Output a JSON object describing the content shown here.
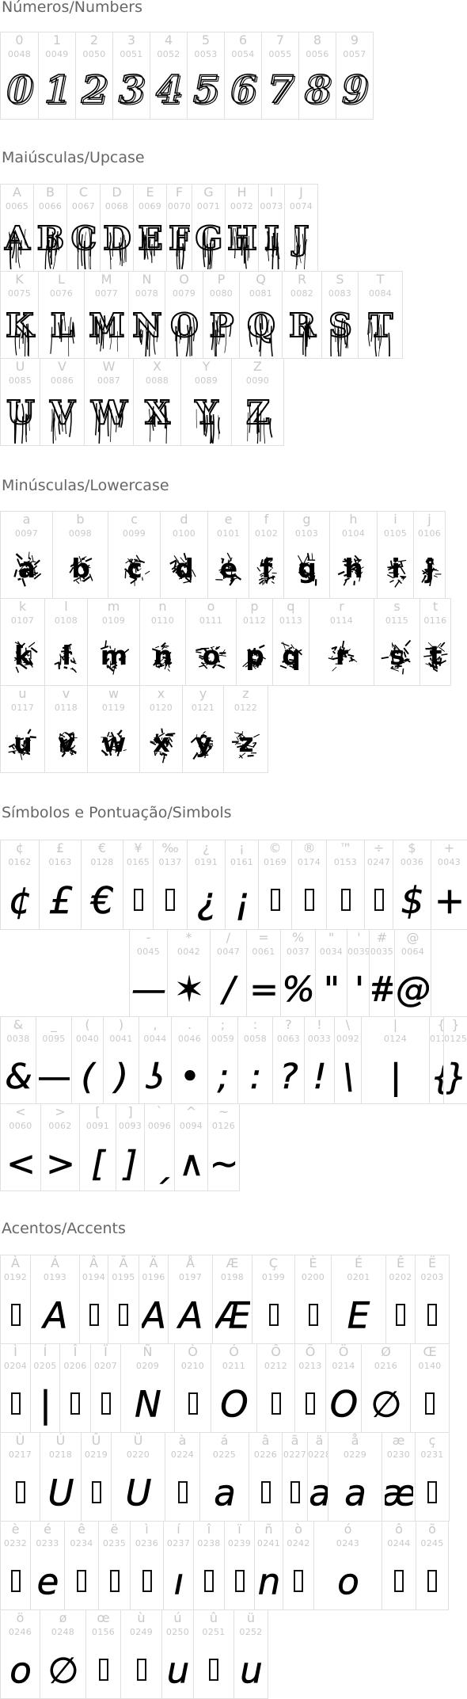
{
  "sections": [
    {
      "title": "Números/Numbers",
      "glyphs": [
        {
          "char": "0",
          "code": "0048",
          "style": "hand"
        },
        {
          "char": "1",
          "code": "0049",
          "style": "hand"
        },
        {
          "char": "2",
          "code": "0050",
          "style": "hand"
        },
        {
          "char": "3",
          "code": "0051",
          "style": "hand"
        },
        {
          "char": "4",
          "code": "0052",
          "style": "hand"
        },
        {
          "char": "5",
          "code": "0053",
          "style": "hand"
        },
        {
          "char": "6",
          "code": "0054",
          "style": "hand"
        },
        {
          "char": "7",
          "code": "0055",
          "style": "hand"
        },
        {
          "char": "8",
          "code": "0056",
          "style": "hand"
        },
        {
          "char": "9",
          "code": "0057",
          "style": "hand"
        }
      ]
    },
    {
      "title": "Maiúsculas/Upcase",
      "glyphs": [
        {
          "char": "A",
          "code": "0065",
          "style": "drip"
        },
        {
          "char": "B",
          "code": "0066",
          "style": "drip"
        },
        {
          "char": "C",
          "code": "0067",
          "style": "drip"
        },
        {
          "char": "D",
          "code": "0068",
          "style": "drip"
        },
        {
          "char": "E",
          "code": "0069",
          "style": "drip"
        },
        {
          "char": "F",
          "code": "0070",
          "style": "drip"
        },
        {
          "char": "G",
          "code": "0071",
          "style": "drip"
        },
        {
          "char": "H",
          "code": "0072",
          "style": "drip"
        },
        {
          "char": "I",
          "code": "0073",
          "style": "drip"
        },
        {
          "char": "J",
          "code": "0074",
          "style": "drip"
        },
        {
          "char": "K",
          "code": "0075",
          "style": "drip"
        },
        {
          "char": "L",
          "code": "0076",
          "style": "drip"
        },
        {
          "char": "M",
          "code": "0077",
          "style": "drip"
        },
        {
          "char": "N",
          "code": "0078",
          "style": "drip"
        },
        {
          "char": "O",
          "code": "0079",
          "style": "drip"
        },
        {
          "char": "P",
          "code": "0080",
          "style": "drip"
        },
        {
          "char": "Q",
          "code": "0081",
          "style": "drip"
        },
        {
          "char": "R",
          "code": "0082",
          "style": "drip"
        },
        {
          "char": "S",
          "code": "0083",
          "style": "drip"
        },
        {
          "char": "T",
          "code": "0084",
          "style": "drip"
        },
        {
          "char": "U",
          "code": "0085",
          "style": "drip"
        },
        {
          "char": "V",
          "code": "0086",
          "style": "drip"
        },
        {
          "char": "W",
          "code": "0087",
          "style": "drip"
        },
        {
          "char": "X",
          "code": "0088",
          "style": "drip"
        },
        {
          "char": "Y",
          "code": "0089",
          "style": "drip"
        },
        {
          "char": "Z",
          "code": "0090",
          "style": "drip"
        }
      ]
    },
    {
      "title": "Minúsculas/Lowercase",
      "glyphs": [
        {
          "char": "a",
          "code": "0097",
          "style": "splat"
        },
        {
          "char": "b",
          "code": "0098",
          "style": "splat"
        },
        {
          "char": "c",
          "code": "0099",
          "style": "splat"
        },
        {
          "char": "d",
          "code": "0100",
          "style": "splat"
        },
        {
          "char": "e",
          "code": "0101",
          "style": "splat"
        },
        {
          "char": "f",
          "code": "0102",
          "style": "splat"
        },
        {
          "char": "g",
          "code": "0103",
          "style": "splat"
        },
        {
          "char": "h",
          "code": "0104",
          "style": "splat"
        },
        {
          "char": "i",
          "code": "0105",
          "style": "splat"
        },
        {
          "char": "j",
          "code": "0106",
          "style": "splat"
        },
        {
          "char": "k",
          "code": "0107",
          "style": "splat"
        },
        {
          "char": "l",
          "code": "0108",
          "style": "splat"
        },
        {
          "char": "m",
          "code": "0109",
          "style": "splat"
        },
        {
          "char": "n",
          "code": "0110",
          "style": "splat"
        },
        {
          "char": "o",
          "code": "0111",
          "style": "splat"
        },
        {
          "char": "p",
          "code": "0112",
          "style": "splat"
        },
        {
          "char": "q",
          "code": "0113",
          "style": "splat"
        },
        {
          "char": "r",
          "code": "0114",
          "style": "splat"
        },
        {
          "char": "s",
          "code": "0115",
          "style": "splat"
        },
        {
          "char": "t",
          "code": "0116",
          "style": "splat"
        },
        {
          "char": "u",
          "code": "0117",
          "style": "splat"
        },
        {
          "char": "v",
          "code": "0118",
          "style": "splat"
        },
        {
          "char": "w",
          "code": "0119",
          "style": "splat"
        },
        {
          "char": "x",
          "code": "0120",
          "style": "splat"
        },
        {
          "char": "y",
          "code": "0121",
          "style": "splat"
        },
        {
          "char": "z",
          "code": "0122",
          "style": "splat"
        }
      ]
    },
    {
      "title": "Símbolos e Pontuação/Simbols",
      "glyphs": [
        {
          "char": "¢",
          "code": "0162",
          "style": "pen",
          "g": "¢"
        },
        {
          "char": "£",
          "code": "0163",
          "style": "pen",
          "g": "£"
        },
        {
          "char": "€",
          "code": "0128",
          "style": "pen",
          "g": "€"
        },
        {
          "char": "¥",
          "code": "0165",
          "style": "box"
        },
        {
          "char": "‰",
          "code": "0137",
          "style": "box"
        },
        {
          "char": "¿",
          "code": "0191",
          "style": "pen",
          "g": "¿"
        },
        {
          "char": "¡",
          "code": "0161",
          "style": "pen",
          "g": "¡"
        },
        {
          "char": "©",
          "code": "0169",
          "style": "box"
        },
        {
          "char": "®",
          "code": "0174",
          "style": "box"
        },
        {
          "char": "™",
          "code": "0153",
          "style": "box"
        },
        {
          "char": "÷",
          "code": "0247",
          "style": "box"
        },
        {
          "char": "$",
          "code": "0036",
          "style": "pen",
          "g": "$"
        },
        {
          "char": "+",
          "code": "0043",
          "style": "pen",
          "g": "+"
        },
        {
          "char": "-",
          "code": "0045",
          "style": "pen",
          "g": "—"
        },
        {
          "char": "*",
          "code": "0042",
          "style": "pen",
          "g": "✶"
        },
        {
          "char": "/",
          "code": "0047",
          "style": "pen",
          "g": "/"
        },
        {
          "char": "=",
          "code": "0061",
          "style": "pen",
          "g": "="
        },
        {
          "char": "%",
          "code": "0037",
          "style": "pen",
          "g": "%"
        },
        {
          "char": "\"",
          "code": "0034",
          "style": "pen",
          "g": "\""
        },
        {
          "char": "'",
          "code": "0039",
          "style": "pen",
          "g": "'"
        },
        {
          "char": "#",
          "code": "0035",
          "style": "pen",
          "g": "#"
        },
        {
          "char": "@",
          "code": "0064",
          "style": "pen",
          "g": "@"
        },
        {
          "char": "&",
          "code": "0038",
          "style": "pen",
          "g": "&"
        },
        {
          "char": "_",
          "code": "0095",
          "style": "pen",
          "g": "—"
        },
        {
          "char": "(",
          "code": "0040",
          "style": "pen",
          "g": "("
        },
        {
          "char": ")",
          "code": "0041",
          "style": "pen",
          "g": ")"
        },
        {
          "char": ",",
          "code": "0044",
          "style": "pen",
          "g": "ʖ"
        },
        {
          "char": ".",
          "code": "0046",
          "style": "pen",
          "g": "•"
        },
        {
          "char": ";",
          "code": "0059",
          "style": "pen",
          "g": ";"
        },
        {
          "char": ":",
          "code": "0058",
          "style": "pen",
          "g": ":"
        },
        {
          "char": "?",
          "code": "0063",
          "style": "pen",
          "g": "?"
        },
        {
          "char": "!",
          "code": "0033",
          "style": "pen",
          "g": "!"
        },
        {
          "char": "\\",
          "code": "0092",
          "style": "pen",
          "g": "\\"
        },
        {
          "char": "|",
          "code": "0124",
          "style": "pen",
          "g": "|"
        },
        {
          "char": "{",
          "code": "0123",
          "style": "pen",
          "g": "{"
        },
        {
          "char": "}",
          "code": "0125",
          "style": "pen",
          "g": "}"
        },
        {
          "char": "<",
          "code": "0060",
          "style": "pen",
          "g": "<"
        },
        {
          "char": ">",
          "code": "0062",
          "style": "pen",
          "g": ">"
        },
        {
          "char": "[",
          "code": "0091",
          "style": "pen",
          "g": "["
        },
        {
          "char": "]",
          "code": "0093",
          "style": "pen",
          "g": "]"
        },
        {
          "char": "`",
          "code": "0096",
          "style": "pen",
          "g": "ˏ"
        },
        {
          "char": "^",
          "code": "0094",
          "style": "pen",
          "g": "∧"
        },
        {
          "char": "~",
          "code": "0126",
          "style": "pen",
          "g": "~"
        }
      ]
    },
    {
      "title": "Acentos/Accents",
      "glyphs": [
        {
          "char": "À",
          "code": "0192",
          "style": "box"
        },
        {
          "char": "Á",
          "code": "0193",
          "style": "pen",
          "g": "A"
        },
        {
          "char": "Â",
          "code": "0194",
          "style": "box"
        },
        {
          "char": "Ã",
          "code": "0195",
          "style": "box"
        },
        {
          "char": "Ä",
          "code": "0196",
          "style": "pen",
          "g": "A"
        },
        {
          "char": "Å",
          "code": "0197",
          "style": "pen",
          "g": "A"
        },
        {
          "char": "Æ",
          "code": "0198",
          "style": "pen",
          "g": "Æ"
        },
        {
          "char": "Ç",
          "code": "0199",
          "style": "box"
        },
        {
          "char": "È",
          "code": "0200",
          "style": "box"
        },
        {
          "char": "É",
          "code": "0201",
          "style": "pen",
          "g": "E"
        },
        {
          "char": "Ê",
          "code": "0202",
          "style": "box"
        },
        {
          "char": "Ë",
          "code": "0203",
          "style": "box"
        },
        {
          "char": "Ì",
          "code": "0204",
          "style": "box"
        },
        {
          "char": "Í",
          "code": "0205",
          "style": "pen",
          "g": "|"
        },
        {
          "char": "Î",
          "code": "0206",
          "style": "box"
        },
        {
          "char": "Ï",
          "code": "0207",
          "style": "box"
        },
        {
          "char": "Ñ",
          "code": "0209",
          "style": "pen",
          "g": "N"
        },
        {
          "char": "Ò",
          "code": "0210",
          "style": "box"
        },
        {
          "char": "Ó",
          "code": "0211",
          "style": "pen",
          "g": "O"
        },
        {
          "char": "Ô",
          "code": "0212",
          "style": "box"
        },
        {
          "char": "Õ",
          "code": "0213",
          "style": "box"
        },
        {
          "char": "Ö",
          "code": "0214",
          "style": "pen",
          "g": "O"
        },
        {
          "char": "Ø",
          "code": "0216",
          "style": "pen",
          "g": "∅"
        },
        {
          "char": "Œ",
          "code": "0140",
          "style": "box"
        },
        {
          "char": "Ù",
          "code": "0217",
          "style": "box"
        },
        {
          "char": "Ú",
          "code": "0218",
          "style": "pen",
          "g": "U"
        },
        {
          "char": "Û",
          "code": "0219",
          "style": "box"
        },
        {
          "char": "Ü",
          "code": "0220",
          "style": "pen",
          "g": "U"
        },
        {
          "char": "à",
          "code": "0224",
          "style": "box"
        },
        {
          "char": "á",
          "code": "0225",
          "style": "pen",
          "g": "a"
        },
        {
          "char": "â",
          "code": "0226",
          "style": "box"
        },
        {
          "char": "ã",
          "code": "0227",
          "style": "box"
        },
        {
          "char": "ä",
          "code": "0228",
          "style": "pen",
          "g": "a"
        },
        {
          "char": "å",
          "code": "0229",
          "style": "pen",
          "g": "a"
        },
        {
          "char": "æ",
          "code": "0230",
          "style": "pen",
          "g": "æ"
        },
        {
          "char": "ç",
          "code": "0231",
          "style": "box"
        },
        {
          "char": "è",
          "code": "0232",
          "style": "box"
        },
        {
          "char": "é",
          "code": "0233",
          "style": "pen",
          "g": "e"
        },
        {
          "char": "ê",
          "code": "0234",
          "style": "box"
        },
        {
          "char": "ë",
          "code": "0235",
          "style": "box"
        },
        {
          "char": "ì",
          "code": "0236",
          "style": "box"
        },
        {
          "char": "í",
          "code": "0237",
          "style": "pen",
          "g": "ı"
        },
        {
          "char": "î",
          "code": "0238",
          "style": "box"
        },
        {
          "char": "ï",
          "code": "0239",
          "style": "box"
        },
        {
          "char": "ñ",
          "code": "0241",
          "style": "pen",
          "g": "n"
        },
        {
          "char": "ò",
          "code": "0242",
          "style": "box"
        },
        {
          "char": "ó",
          "code": "0243",
          "style": "pen",
          "g": "o"
        },
        {
          "char": "ô",
          "code": "0244",
          "style": "box"
        },
        {
          "char": "õ",
          "code": "0245",
          "style": "box"
        },
        {
          "char": "ö",
          "code": "0246",
          "style": "pen",
          "g": "o"
        },
        {
          "char": "ø",
          "code": "0248",
          "style": "pen",
          "g": "∅"
        },
        {
          "char": "œ",
          "code": "0156",
          "style": "box"
        },
        {
          "char": "ù",
          "code": "0249",
          "style": "box"
        },
        {
          "char": "ú",
          "code": "0250",
          "style": "pen",
          "g": "u"
        },
        {
          "char": "û",
          "code": "0251",
          "style": "box"
        },
        {
          "char": "ü",
          "code": "0252",
          "style": "pen",
          "g": "u"
        }
      ]
    }
  ]
}
